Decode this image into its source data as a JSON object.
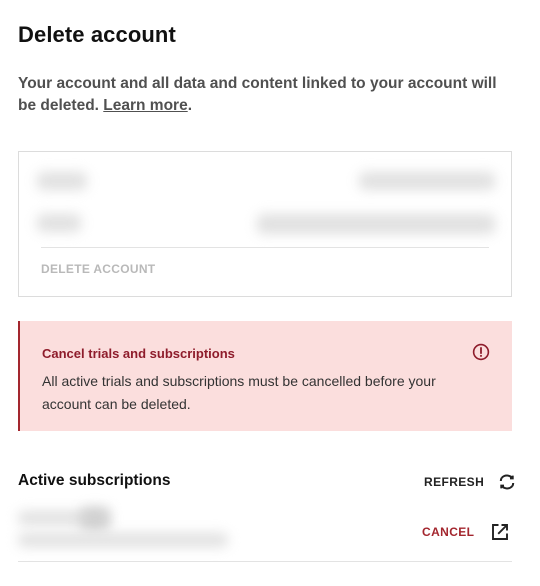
{
  "header": {
    "title": "Delete account"
  },
  "description": {
    "text": "Your account and all data and content linked to your account will be deleted. ",
    "link_label": "Learn more",
    "suffix": "."
  },
  "account_card": {
    "delete_label": "DELETE ACCOUNT"
  },
  "alert": {
    "title": "Cancel trials and subscriptions",
    "body": "All active trials and subscriptions must be cancelled before your account can be deleted.",
    "icon": "exclamation-circle-icon",
    "color": "#8e1c2b",
    "background": "#fbdedd"
  },
  "subscriptions": {
    "title": "Active subscriptions",
    "refresh_label": "REFRESH",
    "refresh_icon": "refresh-icon",
    "items": [
      {
        "cancel_label": "CANCEL",
        "cancel_icon": "external-link-icon"
      }
    ]
  }
}
